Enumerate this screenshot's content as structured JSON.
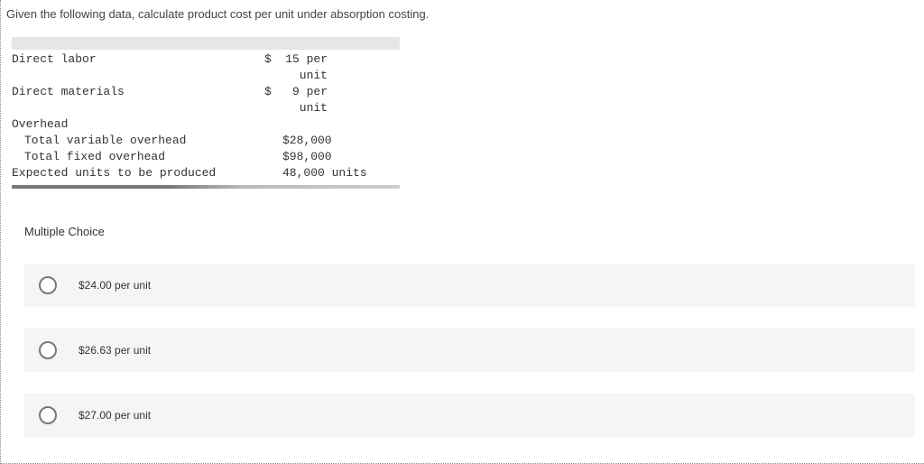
{
  "question": "Given the following data, calculate product cost per unit under absorption costing.",
  "rows": {
    "direct_labor": {
      "label": "Direct labor",
      "sym": "$",
      "val": "15 per unit"
    },
    "direct_materials": {
      "label": "Direct materials",
      "sym": "$",
      "val": "9 per unit"
    },
    "overhead": {
      "label": "Overhead"
    },
    "var_oh": {
      "label": "Total variable overhead",
      "val": "$28,000"
    },
    "fix_oh": {
      "label": "Total fixed overhead",
      "val": "$98,000"
    },
    "expected": {
      "label": "Expected units to be produced",
      "val": "48,000 units"
    }
  },
  "mc": {
    "title": "Multiple Choice",
    "options": [
      {
        "label": "$24.00 per unit"
      },
      {
        "label": "$26.63 per unit"
      },
      {
        "label": "$27.00 per unit"
      }
    ]
  }
}
